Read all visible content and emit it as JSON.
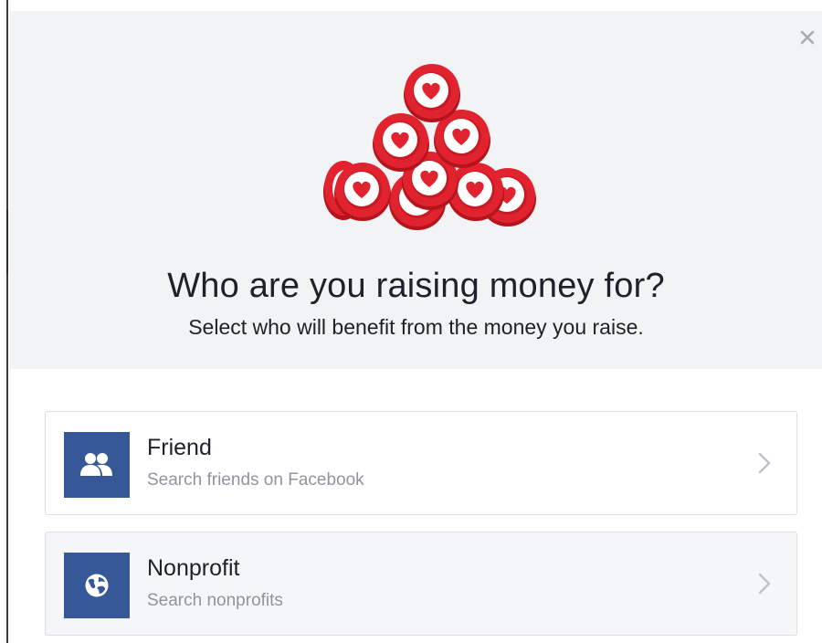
{
  "dialog": {
    "title": "Who are you raising money for?",
    "subtitle": "Select who will benefit from the money you raise.",
    "close_icon": "close-icon",
    "illustration": "heart-coins-pile"
  },
  "options": [
    {
      "label": "Friend",
      "sublabel": "Search friends on Facebook",
      "icon": "friends-icon",
      "chevron": "chevron-right-icon"
    },
    {
      "label": "Nonprofit",
      "sublabel": "Search nonprofits",
      "icon": "globe-icon",
      "chevron": "chevron-right-icon"
    }
  ],
  "colors": {
    "header_bg": "#f2f3f5",
    "icon_bg": "#365899",
    "coin_red": "#e0232e",
    "text_primary": "#1d2129",
    "text_secondary": "#90949c",
    "border": "#dddfe2"
  }
}
